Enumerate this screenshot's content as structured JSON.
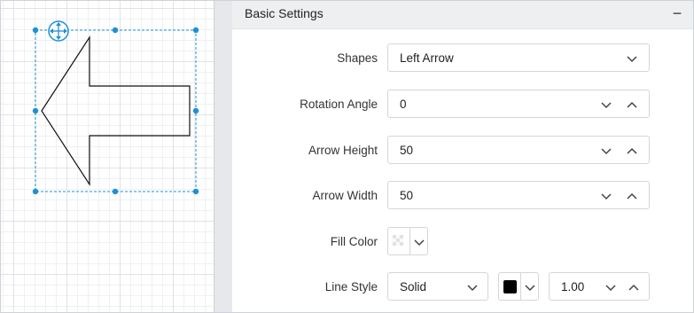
{
  "panel": {
    "title": "Basic Settings",
    "collapse_glyph": "−"
  },
  "rows": {
    "shapes": {
      "label": "Shapes",
      "value": "Left Arrow"
    },
    "rotation": {
      "label": "Rotation Angle",
      "value": "0"
    },
    "arrow_height": {
      "label": "Arrow Height",
      "value": "50"
    },
    "arrow_width": {
      "label": "Arrow Width",
      "value": "50"
    },
    "fill_color": {
      "label": "Fill Color",
      "value_state": "transparent"
    },
    "line_style": {
      "label": "Line Style",
      "style_value": "Solid",
      "color": "#000000",
      "thickness": "1.00"
    }
  },
  "canvas": {
    "shape": "left-arrow",
    "selection_color": "#1e90d6",
    "move_handle_icon": "move-icon"
  }
}
